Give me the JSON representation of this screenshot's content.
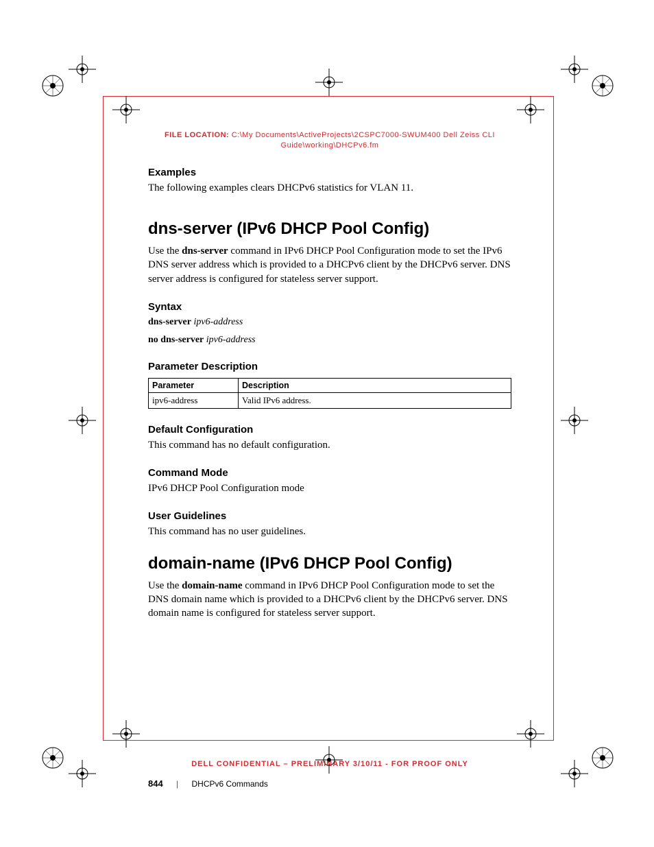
{
  "file_location_label": "FILE LOCATION:",
  "file_location_path": "C:\\My Documents\\ActiveProjects\\2CSPC7000-SWUM400 Dell Zeiss CLI Guide\\working\\DHCPv6.fm",
  "examples": {
    "heading": "Examples",
    "text": "The following examples clears DHCPv6 statistics for VLAN 11."
  },
  "cmd1": {
    "title": "dns-server (IPv6 DHCP Pool Config)",
    "intro_pre": "Use the ",
    "intro_bold": "dns-server",
    "intro_post": " command in IPv6 DHCP Pool Configuration mode to set the IPv6 DNS server address which is provided to a DHCPv6 client by the DHCPv6 server. DNS server address is configured for stateless server support.",
    "syntax_heading": "Syntax",
    "syntax1_bold": "dns-server",
    "syntax1_ital": "ipv6-address",
    "syntax2_bold": "no dns-server",
    "syntax2_ital": "ipv6-address",
    "param_heading": "Parameter Description",
    "param_th1": "Parameter",
    "param_th2": "Description",
    "param_td1": "ipv6-address",
    "param_td2": "Valid IPv6 address.",
    "default_heading": "Default Configuration",
    "default_text": "This command has no default configuration.",
    "mode_heading": "Command Mode",
    "mode_text": " IPv6 DHCP Pool Configuration mode",
    "guidelines_heading": "User Guidelines",
    "guidelines_text": "This command has no user guidelines."
  },
  "cmd2": {
    "title": "domain-name (IPv6 DHCP Pool Config)",
    "intro_pre": "Use the ",
    "intro_bold": "domain-name",
    "intro_post": " command in IPv6 DHCP Pool Configuration mode to set the DNS domain name which is provided to a DHCPv6 client by the DHCPv6 server. DNS domain name is configured for stateless server support."
  },
  "confidential": "DELL CONFIDENTIAL – PRELIMINARY 3/10/11 - FOR PROOF ONLY",
  "footer": {
    "page_number": "844",
    "section": "DHCPv6 Commands"
  }
}
